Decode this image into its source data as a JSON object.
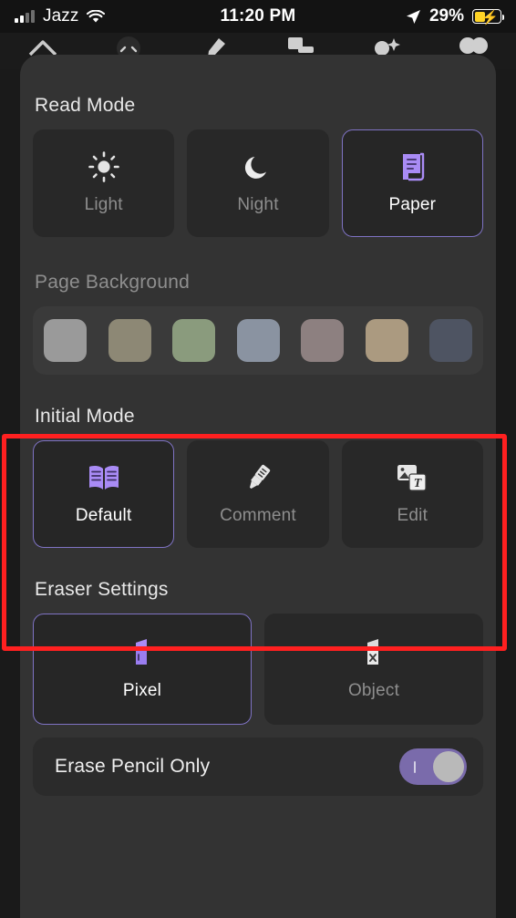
{
  "status_bar": {
    "carrier": "Jazz",
    "signal_icon": "signal-bars-icon",
    "wifi_icon": "wifi-icon",
    "time": "11:20 PM",
    "location_icon": "location-arrow-icon",
    "battery_percent": "29%",
    "battery_icon": "battery-charging-icon",
    "battery_fill_color": "#ffd426"
  },
  "tab_bar": {
    "tabs": [
      {
        "name": "home",
        "icon": "home-icon",
        "glyph": "⌂",
        "active": false
      },
      {
        "name": "annotate",
        "icon": "face-icon",
        "glyph": "◑",
        "active": false
      },
      {
        "name": "highlight",
        "icon": "highlighter-icon",
        "glyph": "✎",
        "active": false
      },
      {
        "name": "media",
        "icon": "image-card-icon",
        "glyph": "▣",
        "active": false
      },
      {
        "name": "effects",
        "icon": "sparkle-icon",
        "glyph": "✦",
        "active": true
      },
      {
        "name": "more",
        "icon": "two-dots-icon",
        "glyph": "●●",
        "active": false
      }
    ],
    "active_underline_color": "#8f7fe0"
  },
  "sections": {
    "read_mode": {
      "title": "Read Mode",
      "options": [
        {
          "label": "Light",
          "icon": "sun-icon",
          "selected": false
        },
        {
          "label": "Night",
          "icon": "moon-icon",
          "selected": false
        },
        {
          "label": "Paper",
          "icon": "scroll-icon",
          "selected": true
        }
      ]
    },
    "page_background": {
      "title": "Page Background",
      "swatches": [
        {
          "name": "swatch-grey",
          "color": "#9a9a9a"
        },
        {
          "name": "swatch-khaki",
          "color": "#8d8875"
        },
        {
          "name": "swatch-sage",
          "color": "#8a9b7d"
        },
        {
          "name": "swatch-blue-grey",
          "color": "#8a93a1"
        },
        {
          "name": "swatch-mauve",
          "color": "#8d8080"
        },
        {
          "name": "swatch-tan",
          "color": "#ab9a80"
        },
        {
          "name": "swatch-slate",
          "color": "#4e5462"
        }
      ]
    },
    "initial_mode": {
      "title": "Initial Mode",
      "highlighted": true,
      "highlight_color": "#ff2020",
      "options": [
        {
          "label": "Default",
          "icon": "open-book-icon",
          "selected": true
        },
        {
          "label": "Comment",
          "icon": "highlighter-pen-icon",
          "selected": false
        },
        {
          "label": "Edit",
          "icon": "image-text-cards-icon",
          "selected": false
        }
      ]
    },
    "eraser_settings": {
      "title": "Eraser Settings",
      "options": [
        {
          "label": "Pixel",
          "icon": "eraser-icon",
          "selected": true
        },
        {
          "label": "Object",
          "icon": "eraser-x-icon",
          "selected": false
        }
      ],
      "toggle": {
        "label": "Erase Pencil Only",
        "value": "on",
        "track_color": "#7a6bab"
      }
    }
  },
  "accent_color": "#a98bf5",
  "selected_border_color": "#7f73c4"
}
